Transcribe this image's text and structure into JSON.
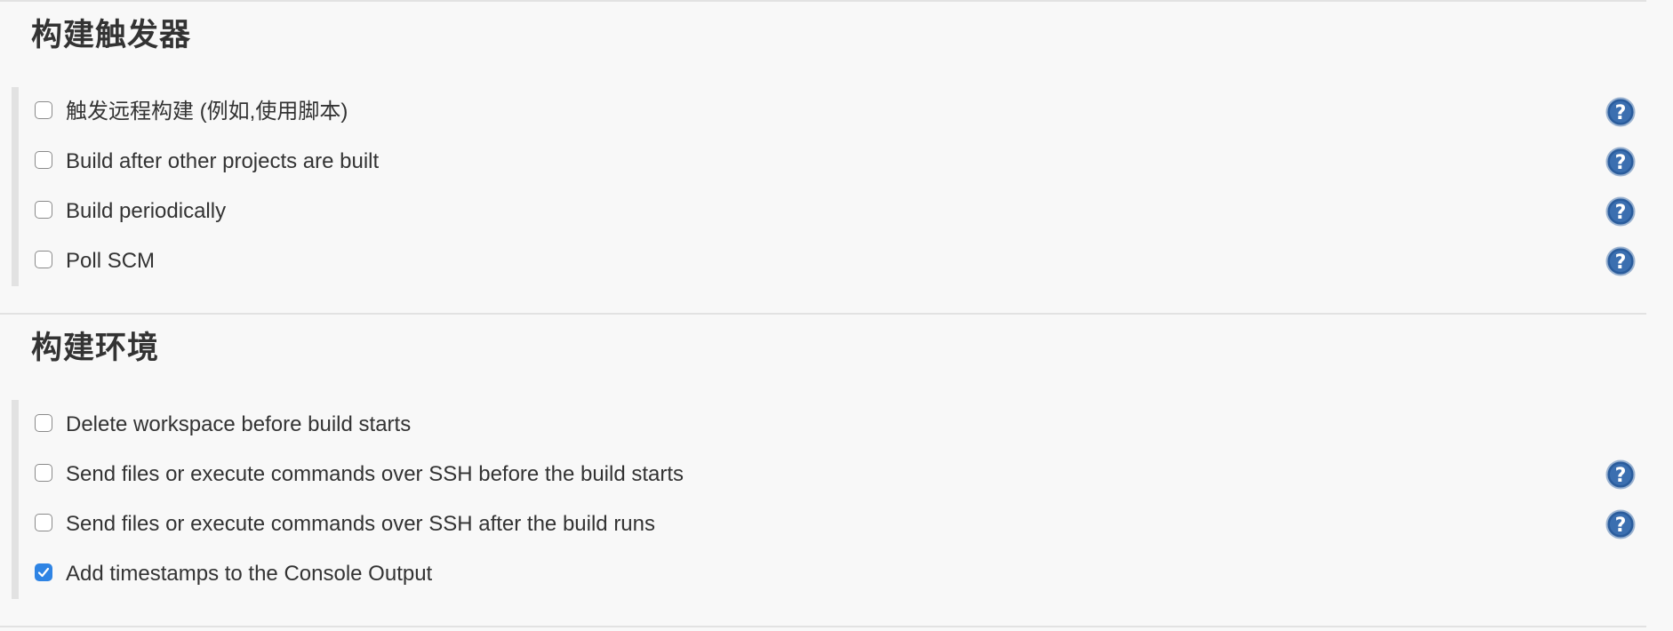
{
  "sections": [
    {
      "title": "构建触发器",
      "items": [
        {
          "label": "触发远程构建 (例如,使用脚本)",
          "checked": false,
          "help": true
        },
        {
          "label": "Build after other projects are built",
          "checked": false,
          "help": true
        },
        {
          "label": "Build periodically",
          "checked": false,
          "help": true
        },
        {
          "label": "Poll SCM",
          "checked": false,
          "help": true
        }
      ]
    },
    {
      "title": "构建环境",
      "items": [
        {
          "label": "Delete workspace before build starts",
          "checked": false,
          "help": false
        },
        {
          "label": "Send files or execute commands over SSH before the build starts",
          "checked": false,
          "help": true
        },
        {
          "label": "Send files or execute commands over SSH after the build runs",
          "checked": false,
          "help": true
        },
        {
          "label": "Add timestamps to the Console Output",
          "checked": true,
          "help": false
        }
      ]
    }
  ],
  "icons": {
    "help": "help-icon",
    "check": "checkmark-icon"
  },
  "colors": {
    "checkbox_checked": "#2f84e4",
    "help_icon": "#2a5c9c"
  }
}
